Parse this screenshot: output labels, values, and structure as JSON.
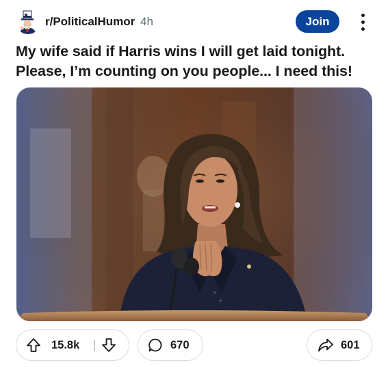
{
  "post": {
    "subreddit": "r/PoliticalHumor",
    "age": "4h",
    "join_label": "Join",
    "title": "My wife said if Harris wins I will get laid tonight. Please, I’m counting on you people... I need this!"
  },
  "actions": {
    "upvotes": "15.8k",
    "comments": "670",
    "shares": "601"
  },
  "icons": {
    "avatar": "uncle-sam-avatar",
    "more": "vertical-ellipsis-icon",
    "upvote": "upvote-arrow-icon",
    "downvote": "downvote-arrow-icon",
    "comment": "speech-bubble-icon",
    "share": "share-arrow-icon"
  },
  "colors": {
    "join_button": "#0a449b",
    "text": "#1a1a1b",
    "muted": "#576f76",
    "pill_border": "#d9dde0"
  }
}
